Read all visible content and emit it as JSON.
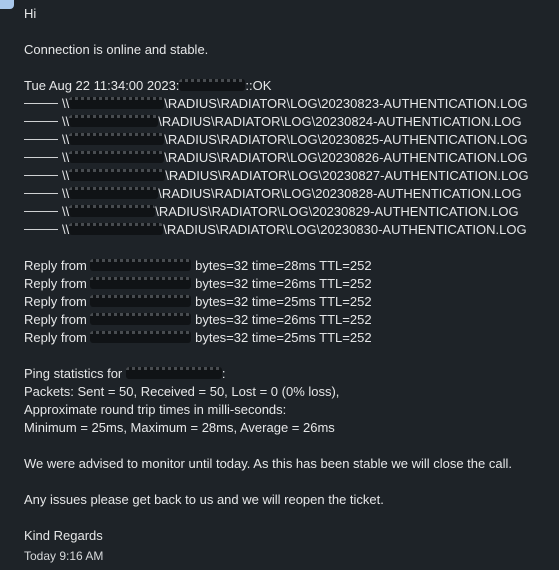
{
  "message": {
    "greeting": "Hi",
    "status": "Connection is online and stable.",
    "check_prefix": "Tue Aug 22 11:34:00 2023:",
    "check_suffix": "::OK",
    "log_prefix": "\\\\",
    "log_paths": [
      "\\RADIUS\\RADIATOR\\LOG\\20230823-AUTHENTICATION.LOG",
      "\\RADIUS\\RADIATOR\\LOG\\20230824-AUTHENTICATION.LOG",
      "\\RADIUS\\RADIATOR\\LOG\\20230825-AUTHENTICATION.LOG",
      "\\RADIUS\\RADIATOR\\LOG\\20230826-AUTHENTICATION.LOG",
      "\\RADIUS\\RADIATOR\\LOG\\20230827-AUTHENTICATION.LOG",
      "\\RADIUS\\RADIATOR\\LOG\\20230828-AUTHENTICATION.LOG",
      "\\RADIUS\\RADIATOR\\LOG\\20230829-AUTHENTICATION.LOG",
      "\\RADIUS\\RADIATOR\\LOG\\20230830-AUTHENTICATION.LOG"
    ],
    "reply_prefix": "Reply from",
    "replies": [
      "bytes=32 time=28ms TTL=252",
      "bytes=32 time=26ms TTL=252",
      "bytes=32 time=25ms TTL=252",
      "bytes=32 time=26ms TTL=252",
      "bytes=32 time=25ms TTL=252"
    ],
    "ping_stats_prefix": "Ping statistics for",
    "ping_stats_suffix": ":",
    "packets": "Packets: Sent = 50, Received = 50, Lost = 0 (0% loss),",
    "approx": "Approximate round trip times in milli-seconds:",
    "minmax": "Minimum = 25ms, Maximum = 28ms, Average = 26ms",
    "advised": "We were advised to monitor until today. As this has been stable we will close the call.",
    "issues": "Any issues please get back to us and we will reopen the ticket.",
    "signoff": "Kind Regards",
    "timestamp": "Today 9:16 AM"
  }
}
